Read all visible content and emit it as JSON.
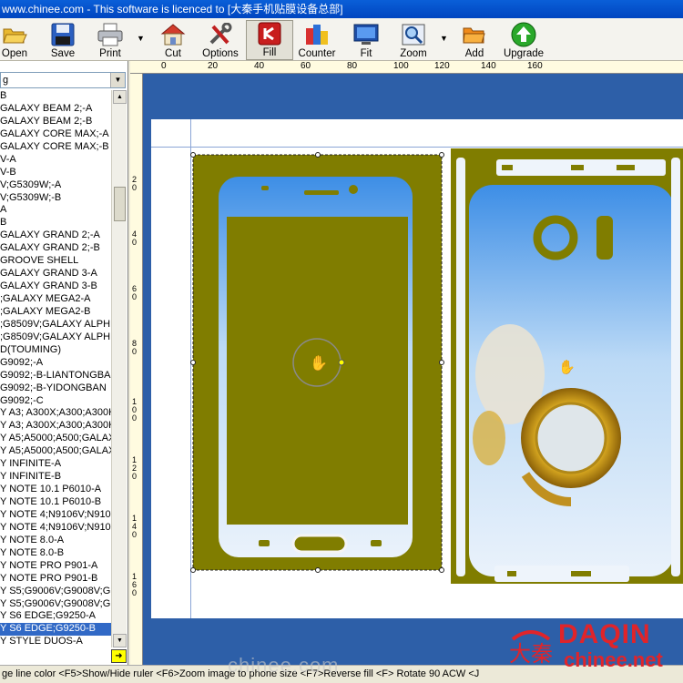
{
  "title_bar": "www.chinee.com - This software is licenced to [大秦手机贴膜设备总部]",
  "toolbar": {
    "open": "Open",
    "save": "Save",
    "print": "Print",
    "cut": "Cut",
    "options": "Options",
    "fill": "Fill",
    "counter": "Counter",
    "fit": "Fit",
    "zoom": "Zoom",
    "add": "Add",
    "upgrade": "Upgrade"
  },
  "model_select": {
    "value": "g"
  },
  "model_list": [
    "B",
    "GALAXY BEAM 2;-A",
    "GALAXY BEAM 2;-B",
    "GALAXY CORE MAX;-A",
    "GALAXY CORE MAX;-B",
    "V-A",
    "V-B",
    "V;G5309W;-A",
    "V;G5309W;-B",
    "A",
    "B",
    "GALAXY GRAND 2;-A",
    "GALAXY GRAND 2;-B",
    "GROOVE SHELL",
    "GALAXY GRAND 3-A",
    "GALAXY GRAND 3-B",
    ";GALAXY MEGA2-A",
    ";GALAXY MEGA2-B",
    ";G8509V;GALAXY ALPH",
    ";G8509V;GALAXY ALPH",
    "D(TOUMING)",
    "G9092;-A",
    "G9092;-B-LIANTONGBAN",
    "G9092;-B-YIDONGBAN",
    "G9092;-C",
    "Y A3; A300X;A300;A300H",
    "Y A3; A300X;A300;A300H",
    "Y A5;A5000;A500;GALAX",
    "Y A5;A5000;A500;GALAX",
    "Y INFINITE-A",
    "Y INFINITE-B",
    "Y NOTE 10.1 P6010-A",
    "Y NOTE 10.1 P6010-B",
    "Y NOTE 4;N9106V;N910;",
    "Y NOTE 4;N9106V;N910;",
    "Y NOTE 8.0-A",
    "Y NOTE 8.0-B",
    "Y NOTE PRO P901-A",
    "Y NOTE PRO P901-B",
    "Y S5;G9006V;G9008V;G",
    "Y S5;G9006V;G9008V;G",
    "Y S6 EDGE;G9250-A",
    "Y S6 EDGE;G9250-B",
    "Y STYLE DUOS-A"
  ],
  "selected_index": 42,
  "ruler_top": [
    "0",
    "20",
    "40",
    "60",
    "80",
    "100",
    "120",
    "140",
    "160"
  ],
  "ruler_left": [
    "20",
    "40",
    "60",
    "80",
    "100",
    "120",
    "140",
    "160"
  ],
  "status_bar": "ge line color <F5>Show/Hide ruler <F6>Zoom image to phone size <F7>Reverse fill <F> Rotate 90 ACW <J",
  "watermark": "chinee.com",
  "logo": {
    "brand": "DAQIN",
    "url": "chinee.net",
    "seal": "大秦"
  },
  "colors": {
    "olive": "#807d00",
    "canvas_blue": "#2d5fa8",
    "selection": "#3169c6",
    "logo_red": "#e0242a"
  }
}
